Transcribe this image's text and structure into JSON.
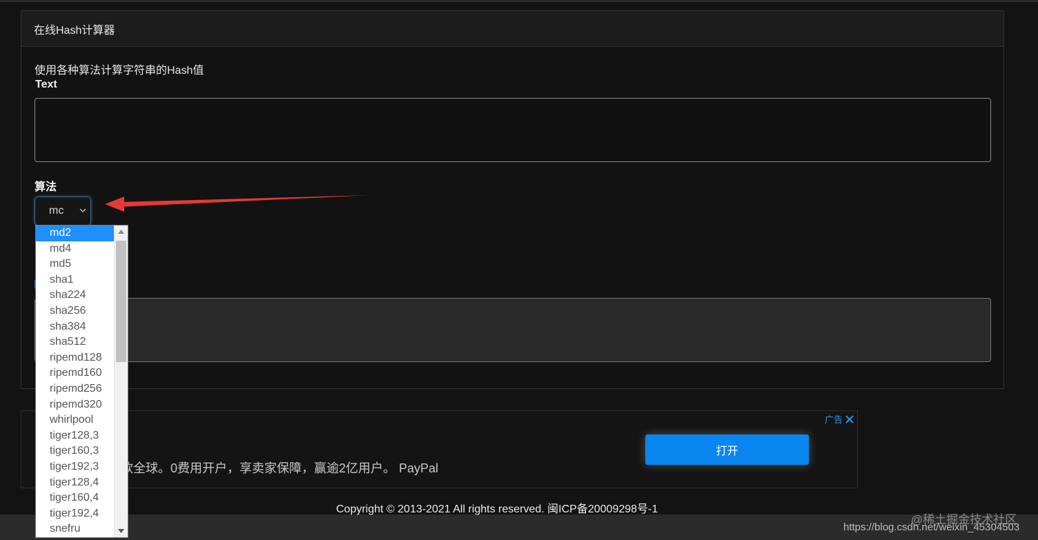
{
  "card": {
    "title": "在线Hash计算器",
    "description": "使用各种算法计算字符串的Hash值",
    "text_label": "Text",
    "text_value": "",
    "algorithm_label": "算法",
    "algorithm_selected": "mc",
    "output_value": ""
  },
  "dropdown": {
    "options": [
      "md2",
      "md4",
      "md5",
      "sha1",
      "sha224",
      "sha256",
      "sha384",
      "sha512",
      "ripemd128",
      "ripemd160",
      "ripemd256",
      "ripemd320",
      "whirlpool",
      "tiger128,3",
      "tiger160,3",
      "tiger192,3",
      "tiger128,4",
      "tiger160,4",
      "tiger192,4",
      "snefru"
    ],
    "highlighted": "md2"
  },
  "ad": {
    "text": "款全球。0费用开户，享卖家保障，赢逾2亿用户。 PayPal",
    "button_label": "打开",
    "tag": "广告",
    "close_icon": "close-icon"
  },
  "footer": {
    "copyright": "Copyright © 2013-2021 All rights reserved. 闽ICP备20009298号-1"
  },
  "watermark": {
    "site": "@稀土掘金技术社区",
    "url": "https://blog.csdn.net/weixin_45304503"
  },
  "annotation": {
    "arrow_color": "#e53935"
  }
}
